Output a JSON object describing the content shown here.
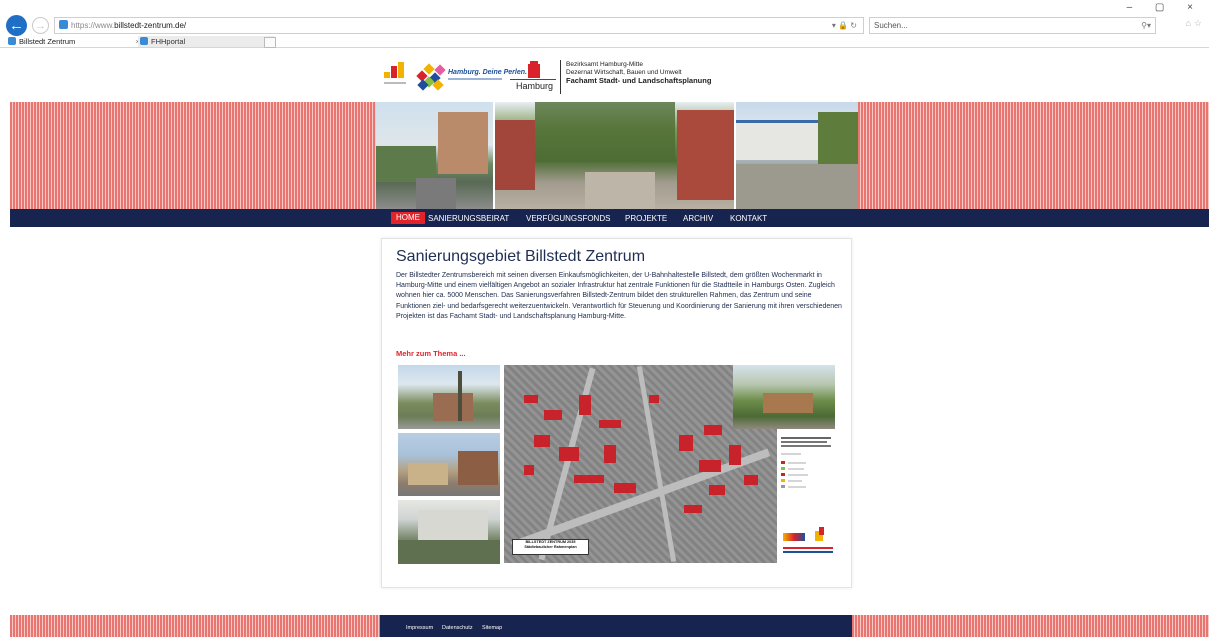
{
  "browser": {
    "url_scheme": "https://www.",
    "url_host": "billstedt-zentrum.de/",
    "search_placeholder": "Suchen...",
    "tabs": [
      {
        "label": "Billstedt Zentrum",
        "close": "×"
      },
      {
        "label": "FHHportal"
      }
    ],
    "window_controls": "– ▢ ×"
  },
  "header": {
    "slogan": "Hamburg. Deine Perlen.",
    "city": "Hamburg",
    "authority_line1": "Bezirksamt Hamburg-Mitte",
    "authority_line2": "Dezernat Wirtschaft, Bauen und Umwelt",
    "authority_line3": "Fachamt Stadt- und Landschaftsplanung"
  },
  "nav": {
    "items": [
      "HOME",
      "SANIERUNGSBEIRAT",
      "VERFÜGUNGSFONDS",
      "PROJEKTE",
      "ARCHIV",
      "KONTAKT"
    ],
    "active": "HOME"
  },
  "main": {
    "title": "Sanierungsgebiet Billstedt Zentrum",
    "body": "Der Billstedter Zentrumsbereich mit seinen diversen Einkaufsmöglichkeiten, der U-Bahnhaltestelle Billstedt, dem größten Wochenmarkt in Hamburg-Mitte und einem vielfältigen Angebot an sozialer Infrastruktur hat zentrale Funktionen für die Stadtteile in Hamburgs Osten. Zugleich wohnen hier ca. 5000 Menschen. Das Sanierungsverfahren Billstedt-Zentrum bildet den strukturellen Rahmen, das Zentrum und seine Funktionen ziel- und bedarfsgerecht weiterzuentwickeln. Verantwortlich für Steuerung und Koordinierung der Sanierung mit ihren verschiedenen Projekten ist das Fachamt Stadt- und Landschaftsplanung Hamburg-Mitte.",
    "more_link": "Mehr zum Thema ...",
    "map_label_line1": "BILLSTEDT ZENTRUM 2035",
    "map_label_line2": "Städtebaulicher Rahmenplan"
  },
  "footer": {
    "links": [
      "Impressum",
      "Datenschutz",
      "Sitemap"
    ]
  },
  "colors": {
    "navy": "#17244f",
    "accent_red": "#e2242a",
    "stripe_red": "#e8756f"
  },
  "icons": [
    "back-arrow-icon",
    "forward-arrow-icon",
    "lock-icon",
    "refresh-icon",
    "search-icon",
    "home-icon",
    "star-icon"
  ]
}
